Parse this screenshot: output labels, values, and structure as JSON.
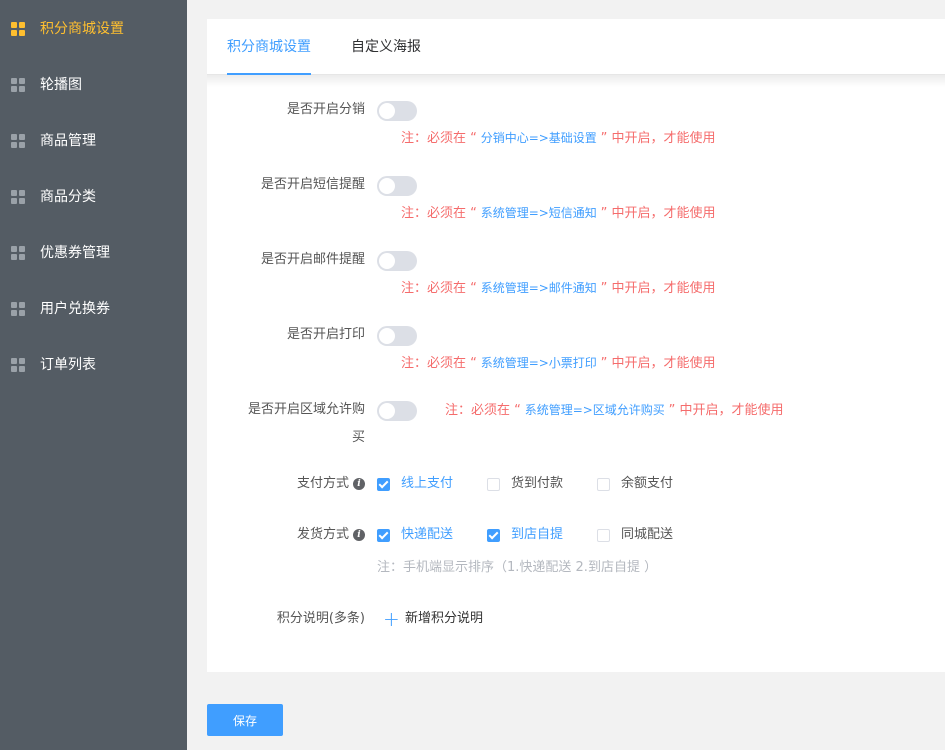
{
  "sidebar": {
    "items": [
      {
        "label": "积分商城设置",
        "active": true
      },
      {
        "label": "轮播图"
      },
      {
        "label": "商品管理"
      },
      {
        "label": "商品分类"
      },
      {
        "label": "优惠券管理"
      },
      {
        "label": "用户兑换券"
      },
      {
        "label": "订单列表"
      }
    ]
  },
  "tabs": [
    {
      "label": "积分商城设置",
      "active": true
    },
    {
      "label": "自定义海报"
    }
  ],
  "form": {
    "distribution": {
      "label": "是否开启分销",
      "enabled": false,
      "note_prefix": "注：必须在 “",
      "note_path": " 分销中心=>基础设置 ",
      "note_suffix": "” 中开启，才能使用"
    },
    "sms": {
      "label": "是否开启短信提醒",
      "enabled": false,
      "note_prefix": "注：必须在 “",
      "note_path": " 系统管理=>短信通知 ",
      "note_suffix": "” 中开启，才能使用"
    },
    "email": {
      "label": "是否开启邮件提醒",
      "enabled": false,
      "note_prefix": "注：必须在 “",
      "note_path": " 系统管理=>邮件通知 ",
      "note_suffix": "” 中开启，才能使用"
    },
    "print": {
      "label": "是否开启打印",
      "enabled": false,
      "note_prefix": "注：必须在 “",
      "note_path": " 系统管理=>小票打印 ",
      "note_suffix": "” 中开启，才能使用"
    },
    "region": {
      "label_line1": "是否开启区域允许购",
      "label_line2": "买",
      "enabled": false,
      "note_prefix": "注：必须在 “",
      "note_path": " 系统管理=>区域允许购买 ",
      "note_suffix": "” 中开启，才能使用"
    },
    "payment": {
      "label": "支付方式",
      "options": [
        {
          "label": "线上支付",
          "checked": true
        },
        {
          "label": "货到付款",
          "checked": false
        },
        {
          "label": "余额支付",
          "checked": false
        }
      ]
    },
    "delivery": {
      "label": "发货方式",
      "options": [
        {
          "label": "快递配送",
          "checked": true
        },
        {
          "label": "到店自提",
          "checked": true
        },
        {
          "label": "同城配送",
          "checked": false
        }
      ],
      "hint": "注：手机端显示排序（1.快递配送 2.到店自提 ）"
    },
    "points_desc": {
      "label": "积分说明(多条)",
      "add_label": "新增积分说明"
    }
  },
  "save_label": "保存",
  "colors": {
    "sidebar_bg": "#545c64",
    "active_accent": "#ffbf2f",
    "primary": "#409eff",
    "note_red": "#f56c6c"
  }
}
